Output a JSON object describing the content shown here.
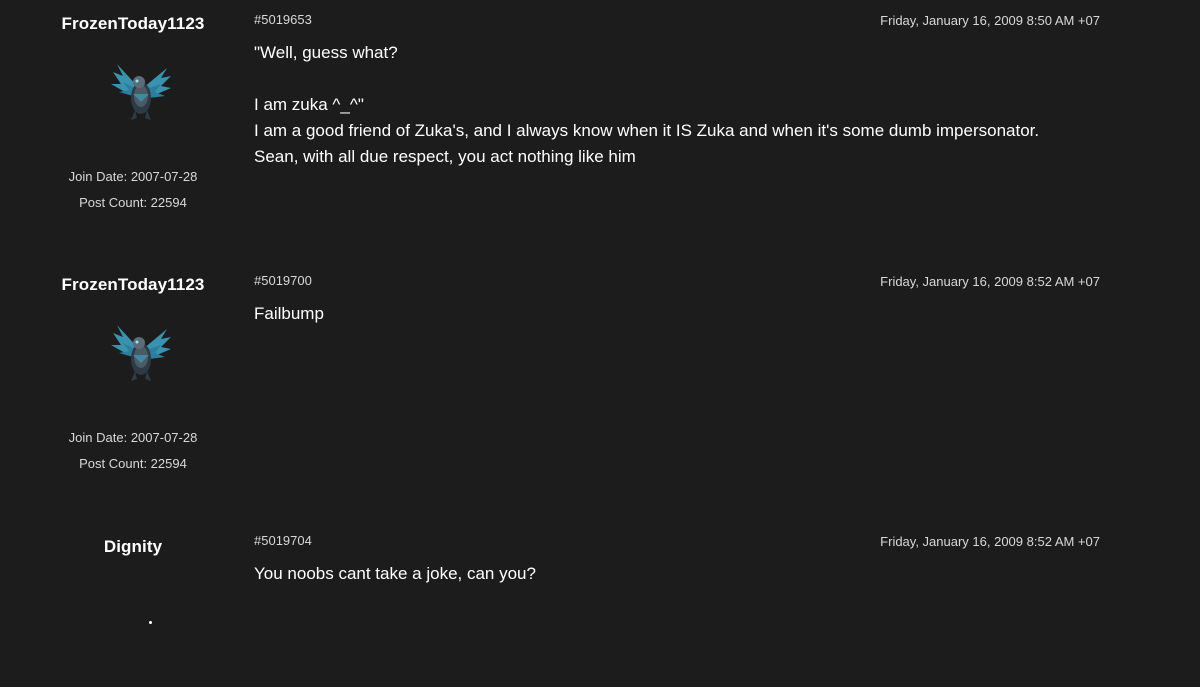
{
  "posts": [
    {
      "username": "FrozenToday1123",
      "avatar_icon": "winged-armored-creature-icon",
      "join_date": "Join Date: 2007-07-28",
      "post_count": "Post Count: 22594",
      "post_id": "#5019653",
      "date": "Friday, January 16, 2009 8:50 AM +07",
      "body_lines": [
        "\"Well, guess what?",
        "",
        "I am zuka ^_^\"",
        "I am a good friend of Zuka's, and I always know when it IS Zuka and when it's some dumb impersonator.",
        "Sean, with all due respect, you act nothing like him"
      ]
    },
    {
      "username": "FrozenToday1123",
      "avatar_icon": "winged-armored-creature-icon",
      "join_date": "Join Date: 2007-07-28",
      "post_count": "Post Count: 22594",
      "post_id": "#5019700",
      "date": "Friday, January 16, 2009 8:52 AM +07",
      "body_lines": [
        "Failbump"
      ]
    },
    {
      "username": "Dignity",
      "avatar_icon": "dot-avatar-icon",
      "post_id": "#5019704",
      "date": "Friday, January 16, 2009 8:52 AM +07",
      "body_lines": [
        "You noobs cant take a joke, can you?"
      ]
    }
  ],
  "colors": {
    "background": "#1c1c1d",
    "text_primary": "#ffffff",
    "text_meta": "#d8d8d8",
    "avatar_accent": "#3fa7c9"
  }
}
